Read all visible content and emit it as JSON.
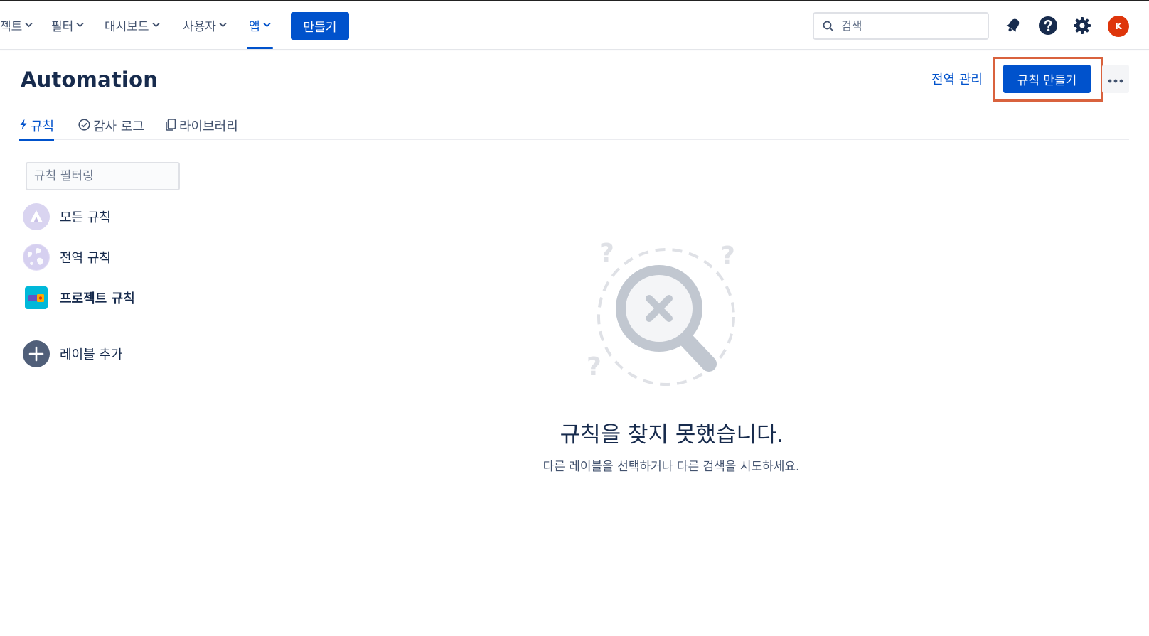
{
  "nav": {
    "items": [
      {
        "label": "젝트",
        "active": false
      },
      {
        "label": "필터",
        "active": false
      },
      {
        "label": "대시보드",
        "active": false
      },
      {
        "label": "사용자",
        "active": false
      },
      {
        "label": "앱",
        "active": true
      }
    ],
    "create_label": "만들기",
    "search_placeholder": "검색",
    "avatar_initial": "K",
    "icons": [
      "search-icon",
      "notification-icon",
      "help-icon",
      "settings-icon"
    ]
  },
  "header": {
    "title": "Automation",
    "global_admin_link": "전역 관리",
    "create_rule_label": "규칙 만들기",
    "more_label": "•••"
  },
  "tabs": [
    {
      "label": "규칙",
      "icon": "lightning-icon",
      "active": true
    },
    {
      "label": "감사 로그",
      "icon": "check-circle-icon",
      "active": false
    },
    {
      "label": "라이브러리",
      "icon": "copy-icon",
      "active": false
    }
  ],
  "sidebar": {
    "filter_placeholder": "규칙 필터링",
    "items": [
      {
        "label": "모든 규칙",
        "icon": "atlassian-logo-icon",
        "selected": false
      },
      {
        "label": "전역 규칙",
        "icon": "globe-icon",
        "selected": false
      },
      {
        "label": "프로젝트 규칙",
        "icon": "project-icon",
        "selected": true
      },
      {
        "label": "레이블 추가",
        "icon": "add-icon",
        "selected": false
      }
    ]
  },
  "empty_state": {
    "title": "규칙을 찾지 못했습니다.",
    "description": "다른 레이블을 선택하거나 다른 검색을 시도하세요."
  },
  "colors": {
    "primary": "#0052cc",
    "text": "#172b4d",
    "subtle_text": "#42526e",
    "highlight_outline": "#d9623d",
    "avatar_bg": "#de350b"
  }
}
